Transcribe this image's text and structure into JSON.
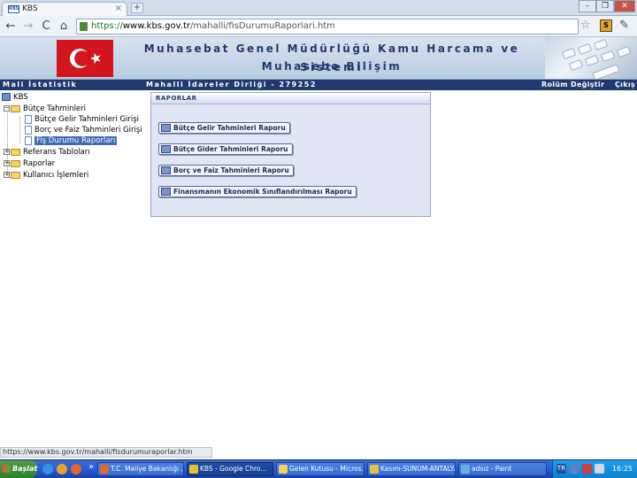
{
  "browser": {
    "tab_title": "KBS",
    "tab_favicon_text": "KBS",
    "tab_close": "×",
    "new_tab": "+",
    "window_controls": [
      "–",
      "❐",
      "✕"
    ],
    "nav": {
      "back": "←",
      "forward": "→",
      "reload": "C",
      "home": "⌂"
    },
    "url_scheme": "https://",
    "url_host": "www.kbs.gov.tr",
    "url_path": "/mahalli/fisDurumuRaporlari.htm",
    "star": "☆",
    "wrench": "✎"
  },
  "banner": {
    "title": "Muhasebat Genel Müdürlüğü Kamu Harcama ve Muhasebe Bilişim",
    "subtitle": "Sistemi",
    "colors": {
      "flag_red": "#d3151d",
      "title_blue": "#203a6e"
    }
  },
  "statusbar": {
    "left": "Mali İstatistik",
    "middle": "Mahalli İdareler Dirliği - 279252",
    "change_role": "Rolüm Değiştir",
    "logout": "Çıkış"
  },
  "tree": {
    "root": "KBS",
    "budget": "Bütçe Tahminleri",
    "items": [
      "Bütçe Gelir Tahminleri Girişi",
      "Borç ve Faiz Tahminleri Girişi",
      "Fiş Durumu Raporları"
    ],
    "others": [
      "Referans Tabloları",
      "Raporlar",
      "Kullanıcı İşlemleri"
    ],
    "expand_minus": "−",
    "expand_plus": "+"
  },
  "panel": {
    "title": "RAPORLAR",
    "buttons": [
      "Bütçe Gelir Tahminleri Raporu",
      "Bütçe Gider Tahminleri Raporu",
      "Borç ve Faiz Tahminleri Raporu",
      "Finansmanın Ekonomik Sınıflandırılması Raporu"
    ]
  },
  "status_url": "https://www.kbs.gov.tr/mahalli/fisdurumuraporlar.htm",
  "taskbar": {
    "start": "Başlat",
    "quick_more": "»",
    "tasks": [
      "T.C. Maliye Bakanlığı ...",
      "KBS - Google Chro...",
      "Gelen Kutusu - Micros...",
      "Kasım-SUNUM-ANTALYA",
      "adsız - Paint"
    ],
    "lang": "TR",
    "clock": "16:25"
  }
}
